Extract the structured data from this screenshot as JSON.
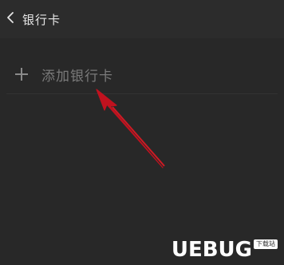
{
  "header": {
    "title": "银行卡",
    "back_icon": "chevron-left-icon"
  },
  "add_card": {
    "label": "添加银行卡",
    "icon": "plus-icon"
  },
  "colors": {
    "background": "#262626",
    "header": "#2c2c2c",
    "text_primary": "#e6e6e6",
    "text_secondary": "#7a7a7a",
    "annotation_arrow": "#c0121f"
  },
  "watermark": {
    "logo_text": "UEBUG",
    "badge_text": "下载站"
  }
}
